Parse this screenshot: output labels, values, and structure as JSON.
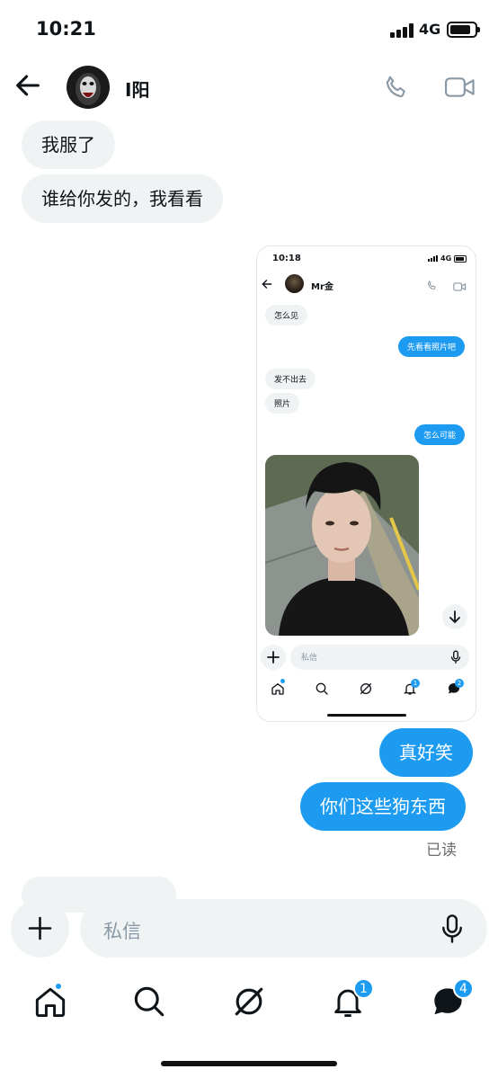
{
  "status_bar": {
    "time": "10:21",
    "network": "4G"
  },
  "header": {
    "contact_name": "I阳"
  },
  "messages": [
    {
      "text": "我服了",
      "direction": "incoming"
    },
    {
      "text": "谁给你发的，我看看",
      "direction": "incoming"
    },
    {
      "text": "真好笑",
      "direction": "outgoing"
    },
    {
      "text": "你们这些狗东西",
      "direction": "outgoing"
    }
  ],
  "read_receipt": "已读",
  "embedded_screenshot": {
    "time": "10:18",
    "network": "4G",
    "contact_name": "Mr金",
    "messages": [
      {
        "text": "怎么见",
        "direction": "incoming"
      },
      {
        "text": "先看看照片吧",
        "direction": "outgoing"
      },
      {
        "text": "发不出去",
        "direction": "incoming"
      },
      {
        "text": "照片",
        "direction": "incoming"
      },
      {
        "text": "怎么可能",
        "direction": "outgoing"
      }
    ],
    "input_placeholder": "私信",
    "nav_badges": {
      "notifications": "1",
      "messages": "2"
    }
  },
  "composer": {
    "placeholder": "私信"
  },
  "nav": {
    "items": [
      "home",
      "search",
      "grok",
      "notifications",
      "messages"
    ],
    "notifications_badge": "1",
    "messages_badge": "4"
  },
  "colors": {
    "accent": "#1d9bf0",
    "bubble_incoming": "#eff3f4",
    "text": "#0f1419"
  }
}
